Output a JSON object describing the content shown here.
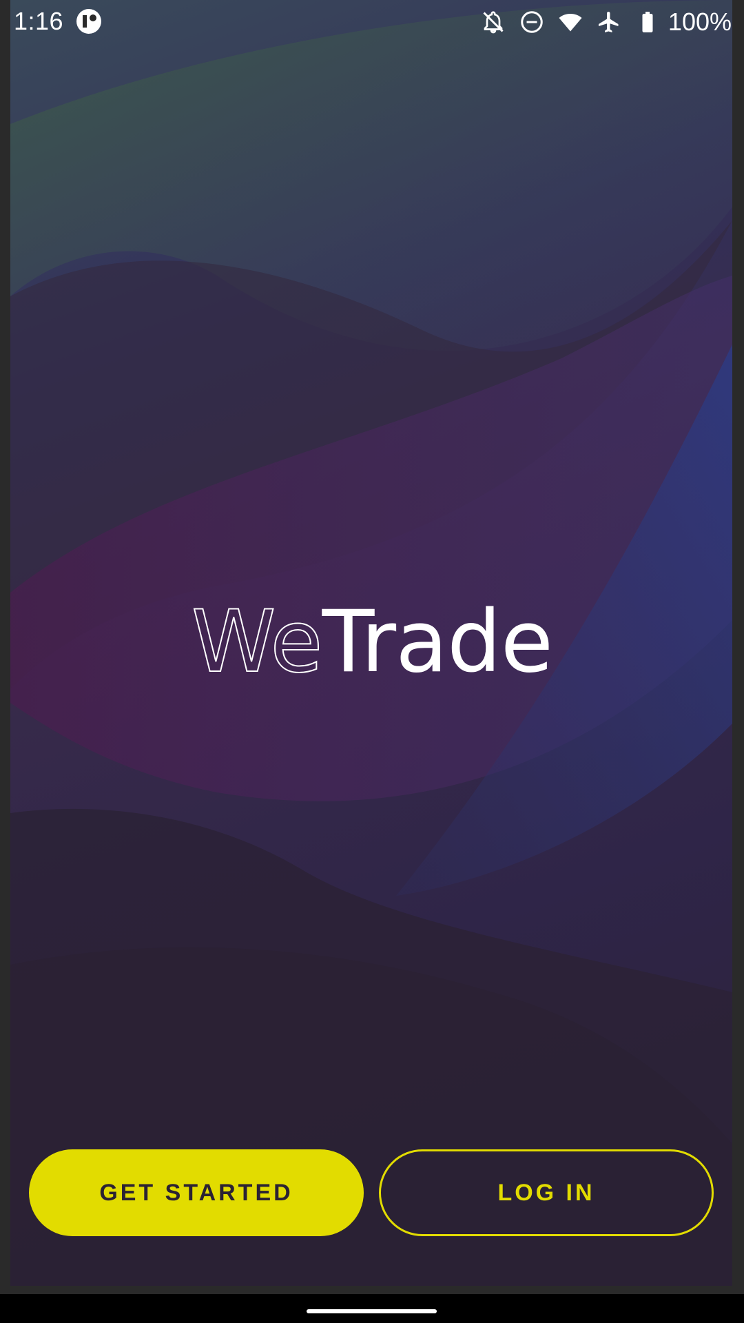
{
  "status_bar": {
    "time": "1:16",
    "battery": "100%",
    "icons": [
      "app-notification-icon",
      "notifications-off-icon",
      "do-not-disturb-icon",
      "wifi-icon",
      "airplane-mode-icon",
      "battery-icon"
    ]
  },
  "logo": {
    "part1": "We",
    "part2": "Trade"
  },
  "actions": {
    "get_started": "GET STARTED",
    "log_in": "LOG IN"
  },
  "colors": {
    "accent": "#e2dc00",
    "button_text_dark": "#2b2233"
  }
}
